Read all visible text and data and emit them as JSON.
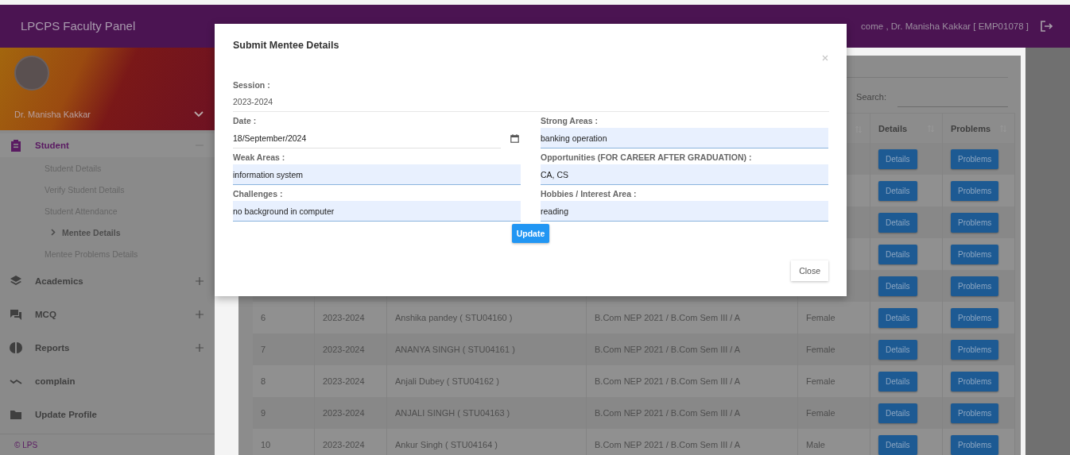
{
  "header": {
    "title": "LPCPS Faculty Panel",
    "welcome": "come , Dr. Manisha Kakkar [ EMP01078 ]"
  },
  "sidebar": {
    "user": "Dr. Manisha Kakkar",
    "items": [
      {
        "label": "Student",
        "kind": "group",
        "expanded": true,
        "children": [
          {
            "label": "Student Details",
            "selected": false
          },
          {
            "label": "Verify Student Details",
            "selected": false
          },
          {
            "label": "Student Attendance",
            "selected": false
          },
          {
            "label": "Mentee Details",
            "selected": true
          },
          {
            "label": "Mentee Problems Details",
            "selected": false
          }
        ]
      },
      {
        "label": "Academics",
        "kind": "group",
        "expanded": false
      },
      {
        "label": "MCQ",
        "kind": "group",
        "expanded": false
      },
      {
        "label": "Reports",
        "kind": "group",
        "expanded": false
      },
      {
        "label": "complain",
        "kind": "link"
      },
      {
        "label": "Update Profile",
        "kind": "link"
      }
    ],
    "footer": "© LPS"
  },
  "table": {
    "search_label": "Search:",
    "columns": [
      "Details",
      "Problems"
    ],
    "rows": [
      {
        "details": "Details",
        "problems": "Problems"
      },
      {
        "details": "Details",
        "problems": "Problems"
      },
      {
        "details": "Details",
        "problems": "Problems"
      },
      {
        "details": "Details",
        "problems": "Problems"
      },
      {
        "details": "Details",
        "problems": "Problems"
      },
      {
        "cells": [
          "6",
          "2023-2024",
          "Anshika pandey ( STU04160 )",
          "B.Com NEP 2021 / B.Com Sem III / A",
          "Female"
        ],
        "details": "Details",
        "problems": "Problems"
      },
      {
        "cells": [
          "7",
          "2023-2024",
          "ANANYA SINGH ( STU04161 )",
          "B.Com NEP 2021 / B.Com Sem III / A",
          "Female"
        ],
        "details": "Details",
        "problems": "Problems"
      },
      {
        "cells": [
          "8",
          "2023-2024",
          "Anjali Dubey ( STU04162 )",
          "B.Com NEP 2021 / B.Com Sem III / A",
          "Female"
        ],
        "details": "Details",
        "problems": "Problems"
      },
      {
        "cells": [
          "9",
          "2023-2024",
          "ANJALI SINGH ( STU04163 )",
          "B.Com NEP 2021 / B.Com Sem III / A",
          "Female"
        ],
        "details": "Details",
        "problems": "Problems"
      },
      {
        "cells": [
          "10",
          "2023-2024",
          "Ankur Singh ( STU04164 )",
          "B.Com NEP 2021 / B.Com Sem III / A",
          "Male"
        ],
        "details": "Details",
        "problems": "Problems"
      }
    ]
  },
  "modal": {
    "title": "Submit Mentee Details",
    "session_label": "Session :",
    "session": "2023-2024",
    "fields": [
      {
        "label": "Date :",
        "value": "18/September/2024",
        "kind": "date"
      },
      {
        "label": "Strong Areas :",
        "value": "banking operation",
        "kind": "text"
      },
      {
        "label": "Weak Areas :",
        "value": "information system",
        "kind": "text"
      },
      {
        "label": "Opportunities (FOR CAREER AFTER GRADUATION) :",
        "value": "CA, CS",
        "kind": "text"
      },
      {
        "label": "Challenges :",
        "value": "no background in computer",
        "kind": "text"
      },
      {
        "label": "Hobbies / Interest Area :",
        "value": "reading",
        "kind": "text"
      }
    ],
    "update": "Update",
    "close": "Close"
  }
}
